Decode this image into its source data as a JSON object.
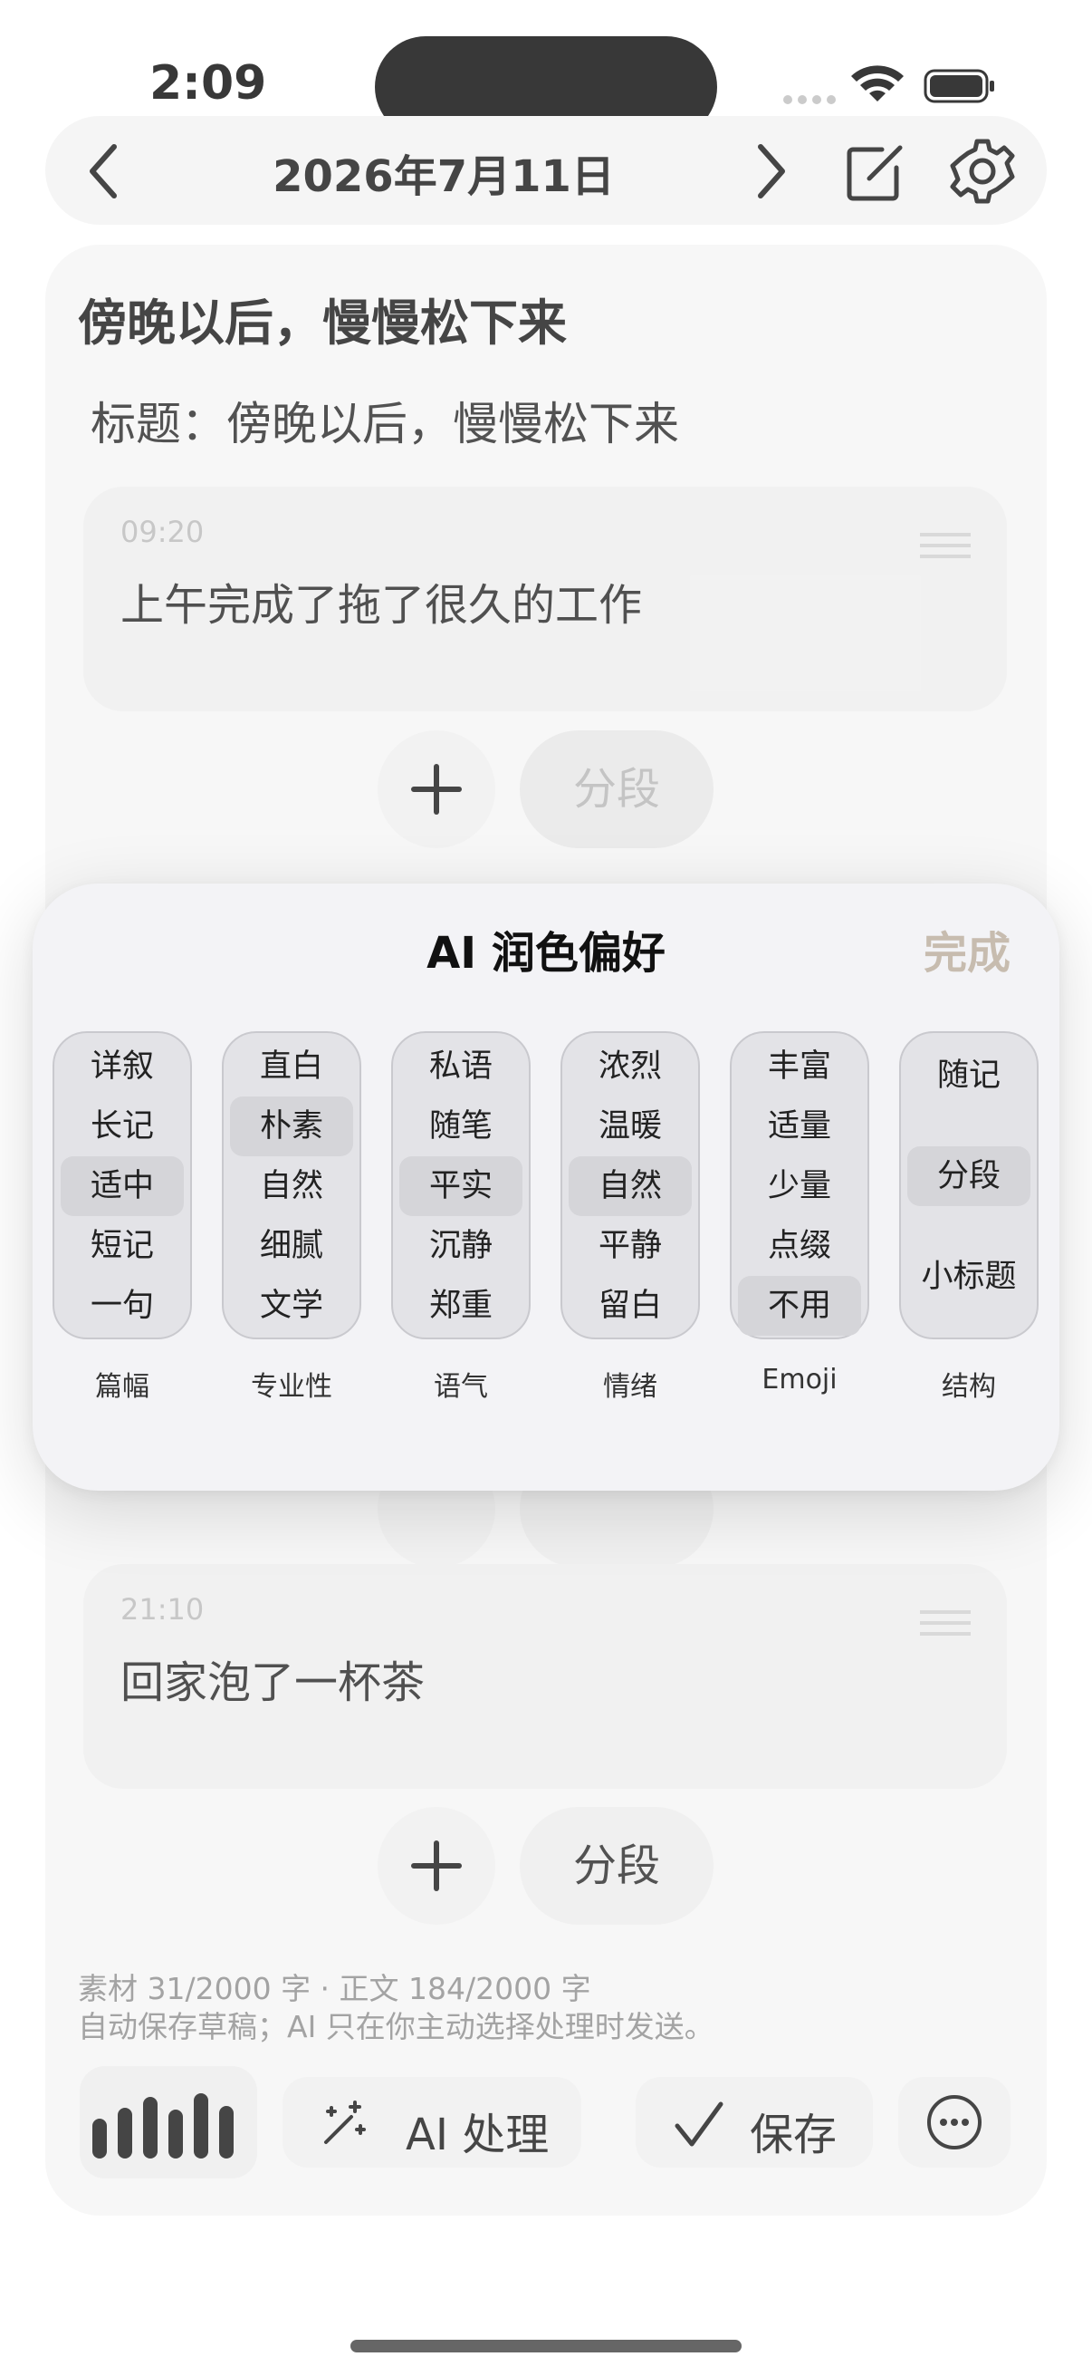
{
  "status_bar": {
    "time": "2:09"
  },
  "topbar": {
    "date": "2026年7月11日"
  },
  "journal": {
    "heading": "傍晚以后，慢慢松下来",
    "title_line": "标题：傍晚以后，慢慢松下来",
    "entries": [
      {
        "time": "09:20",
        "text": "上午完成了拖了很久的工作"
      },
      {
        "time": "21:10",
        "text": "回家泡了一杯茶"
      }
    ],
    "segment_label": "分段"
  },
  "popup": {
    "title": "AI 润色偏好",
    "done": "完成",
    "columns": [
      {
        "label": "篇幅",
        "options": [
          "详叙",
          "长记",
          "适中",
          "短记",
          "一句"
        ],
        "selected": "适中"
      },
      {
        "label": "专业性",
        "options": [
          "直白",
          "朴素",
          "自然",
          "细腻",
          "文学"
        ],
        "selected": "朴素"
      },
      {
        "label": "语气",
        "options": [
          "私语",
          "随笔",
          "平实",
          "沉静",
          "郑重"
        ],
        "selected": "平实"
      },
      {
        "label": "情绪",
        "options": [
          "浓烈",
          "温暖",
          "自然",
          "平静",
          "留白"
        ],
        "selected": "自然"
      },
      {
        "label": "Emoji",
        "options": [
          "丰富",
          "适量",
          "少量",
          "点缀",
          "不用"
        ],
        "selected": "不用"
      },
      {
        "label": "结构",
        "options": [
          "随记",
          "分段",
          "小标题"
        ],
        "selected": "分段"
      }
    ]
  },
  "footer": {
    "counts": "素材 31/2000 字 · 正文 184/2000 字",
    "note": "自动保存草稿；AI 只在你主动选择处理时发送。",
    "ai_button": "AI 处理",
    "save_button": "保存"
  },
  "colors": {
    "done_accent": "#c7bcaf",
    "sheet_bg": "#f3f3f6"
  }
}
